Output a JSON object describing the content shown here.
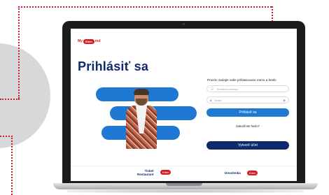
{
  "app": {
    "logo_left": "My",
    "logo_pill": "Eden",
    "logo_right": "red"
  },
  "page": {
    "title": "Prihlásiť sa"
  },
  "login": {
    "prompt": "Prosím zadajte vaše prihlasovacie meno a heslo",
    "email_placeholder": "Emailová adresa",
    "password_placeholder": "Heslo",
    "login_label": "Prihlásiť sa",
    "forgot_label": "Zabudli ste heslo?",
    "create_label": "Vytvoriť účet"
  },
  "footer": {
    "brand1_line1": "Ticket",
    "brand1_line2": "Restaurant",
    "brand1_pill": "Eden",
    "brand2_text": "Dovolenka",
    "brand2_pill": "Eden"
  },
  "icons": {
    "user": "user-icon",
    "lock": "lock-icon",
    "eye": "eye-icon"
  },
  "colors": {
    "accent_red": "#d01f28",
    "primary_blue": "#1f78d1",
    "navy": "#0f2b6b"
  }
}
